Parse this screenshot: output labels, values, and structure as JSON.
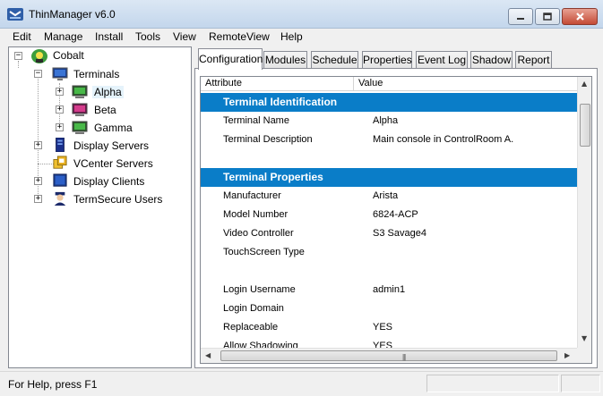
{
  "window": {
    "title": "ThinManager v6.0"
  },
  "menu": [
    "Edit",
    "Manage",
    "Install",
    "Tools",
    "View",
    "RemoteView",
    "Help"
  ],
  "tree": {
    "root": "Cobalt",
    "terminals": "Terminals",
    "terminal_items": [
      "Alpha",
      "Beta",
      "Gamma"
    ],
    "display_servers": "Display Servers",
    "vcenter_servers": "VCenter Servers",
    "display_clients": "Display Clients",
    "termsecure_users": "TermSecure Users"
  },
  "tabs": [
    "Configuration",
    "Modules",
    "Schedule",
    "Properties",
    "Event Log",
    "Shadow",
    "Report"
  ],
  "grid": {
    "col_attribute": "Attribute",
    "col_value": "Value",
    "section1": "Terminal Identification",
    "rows1": [
      {
        "attr": "Terminal Name",
        "val": "Alpha"
      },
      {
        "attr": "Terminal Description",
        "val": "Main console in ControlRoom A."
      }
    ],
    "section2": "Terminal Properties",
    "rows2": [
      {
        "attr": "Manufacturer",
        "val": "Arista"
      },
      {
        "attr": "Model Number",
        "val": "6824-ACP"
      },
      {
        "attr": "Video Controller",
        "val": "S3 Savage4"
      },
      {
        "attr": "TouchScreen Type",
        "val": ""
      },
      {
        "attr": "",
        "val": ""
      },
      {
        "attr": "Login Username",
        "val": "admin1"
      },
      {
        "attr": "Login Domain",
        "val": ""
      },
      {
        "attr": "Replaceable",
        "val": "YES"
      },
      {
        "attr": "Allow Shadowing",
        "val": "YES"
      }
    ]
  },
  "status": {
    "text": "For Help, press F1"
  },
  "colors": {
    "section_bg": "#0a7dc8",
    "selected_bg": "#e5f3fb"
  }
}
